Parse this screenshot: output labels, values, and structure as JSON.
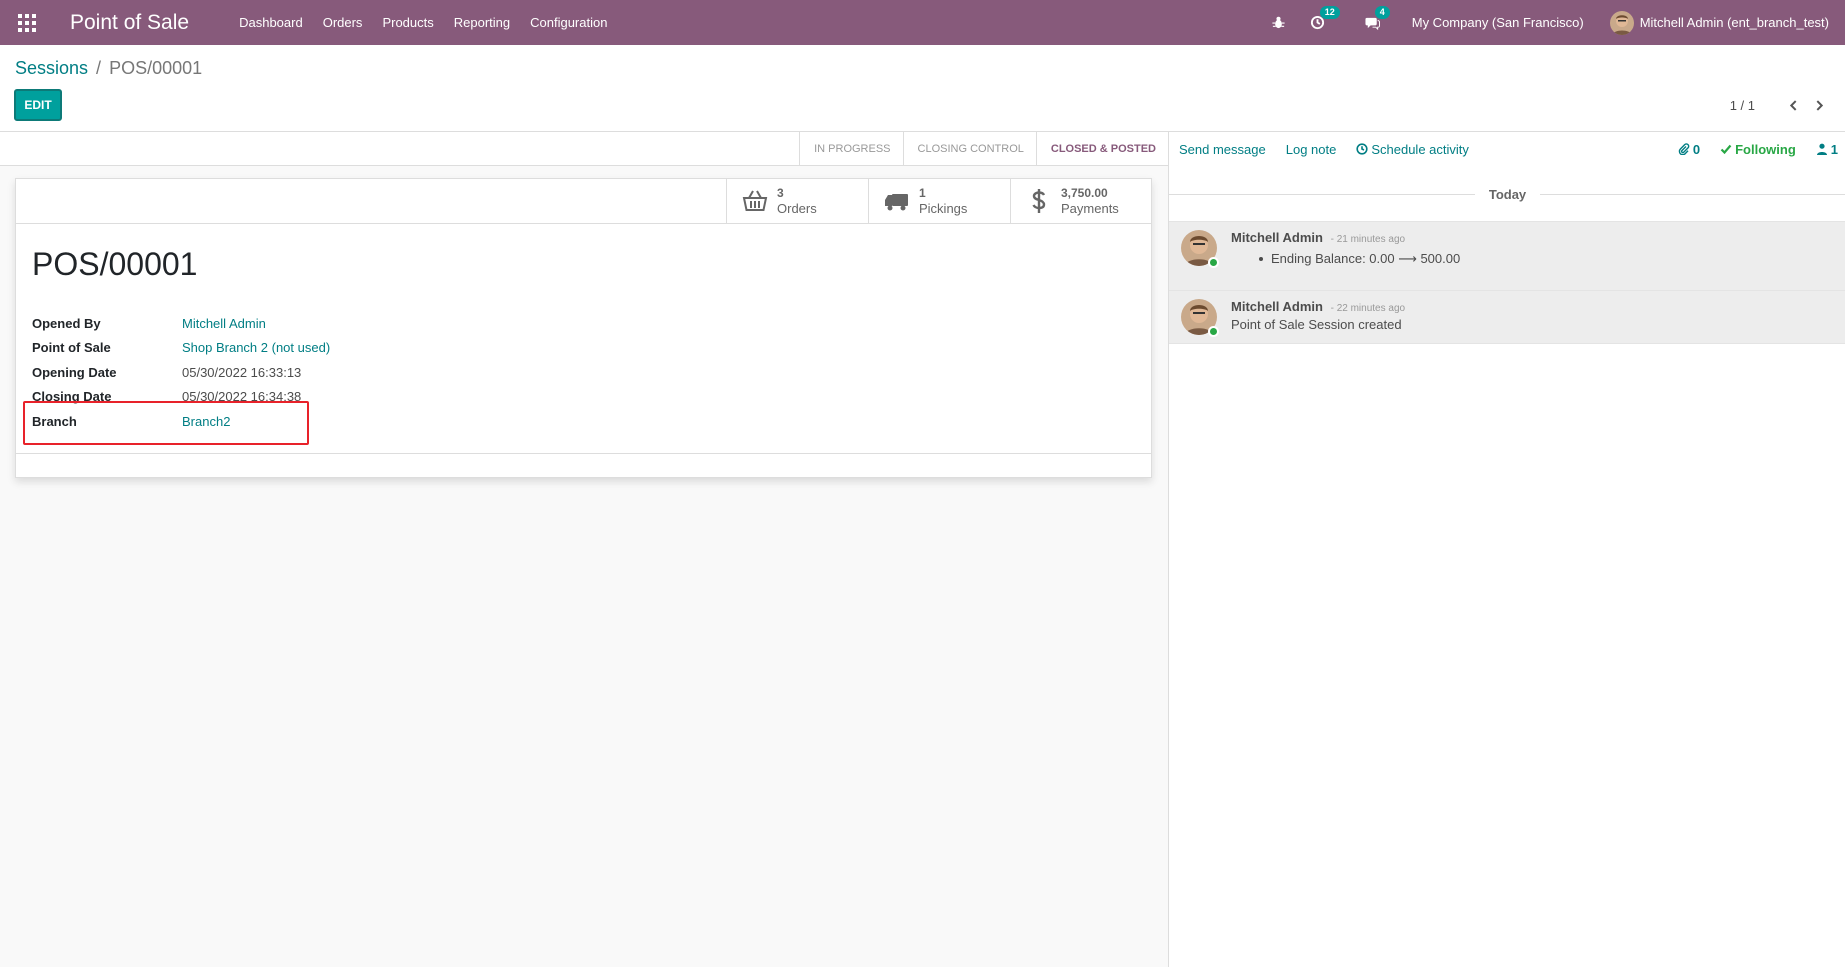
{
  "navbar": {
    "app_title": "Point of Sale",
    "menu": [
      "Dashboard",
      "Orders",
      "Products",
      "Reporting",
      "Configuration"
    ],
    "activity_count": "12",
    "message_count": "4",
    "company": "My Company (San Francisco)",
    "user": "Mitchell Admin (ent_branch_test)"
  },
  "breadcrumb": {
    "parent": "Sessions",
    "separator": "/",
    "current": "POS/00001"
  },
  "actions": {
    "edit_label": "EDIT"
  },
  "pager": {
    "value": "1 / 1"
  },
  "statusbar": {
    "stages": [
      "IN PROGRESS",
      "CLOSING CONTROL",
      "CLOSED & POSTED"
    ],
    "active_stage": "CLOSED & POSTED"
  },
  "smart_buttons": [
    {
      "value": "3",
      "label": "Orders",
      "icon": "basket-icon"
    },
    {
      "value": "1",
      "label": "Pickings",
      "icon": "truck-icon"
    },
    {
      "value": "3,750.00",
      "label": "Payments",
      "icon": "dollar-icon"
    }
  ],
  "record": {
    "title": "POS/00001",
    "fields": [
      {
        "label": "Opened By",
        "value": "Mitchell Admin",
        "link": true
      },
      {
        "label": "Point of Sale",
        "value": "Shop Branch 2 (not used)",
        "link": true
      },
      {
        "label": "Opening Date",
        "value": "05/30/2022 16:33:13",
        "link": false
      },
      {
        "label": "Closing Date",
        "value": "05/30/2022 16:34:38",
        "link": false
      },
      {
        "label": "Branch",
        "value": "Branch2",
        "link": true
      }
    ],
    "highlight_color": "#e8222a"
  },
  "chatter": {
    "send_message": "Send message",
    "log_note": "Log note",
    "schedule_activity": "Schedule activity",
    "attachments": "0",
    "following": "Following",
    "followers": "1",
    "date_separator": "Today",
    "messages": [
      {
        "author": "Mitchell Admin",
        "time": "- 21 minutes ago",
        "body": "Ending Balance: 0.00 ⟶ 500.00",
        "bullet": true
      },
      {
        "author": "Mitchell Admin",
        "time": "- 22 minutes ago",
        "body": "Point of Sale Session created",
        "bullet": false
      }
    ]
  },
  "colors": {
    "brand": "#875a7b",
    "accent": "#00a09d",
    "link": "#017e84",
    "following": "#28a745"
  }
}
